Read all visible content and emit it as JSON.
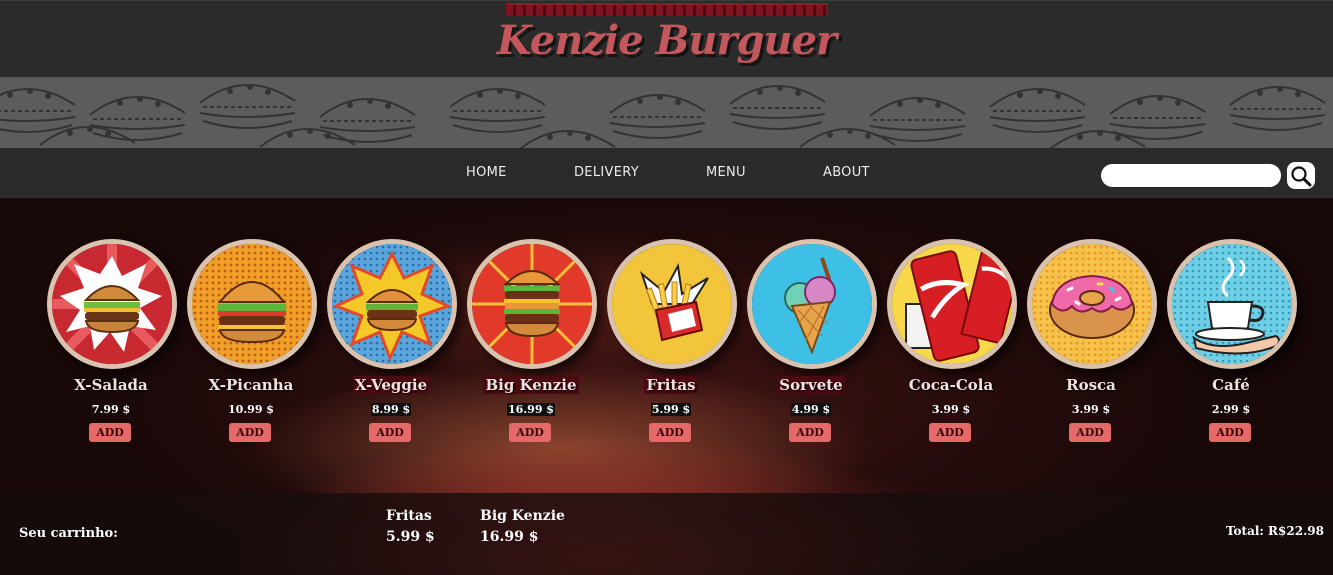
{
  "header": {
    "logo": "Kenzie Burguer"
  },
  "nav": {
    "items": [
      {
        "label": "HOME"
      },
      {
        "label": "DELIVERY"
      },
      {
        "label": "MENU"
      },
      {
        "label": "ABOUT"
      }
    ],
    "search": {
      "value": "",
      "placeholder": ""
    }
  },
  "products": [
    {
      "name": "X-Salada",
      "price": "7.99 $",
      "add": "ADD",
      "icon": "burger-pop-art-icon"
    },
    {
      "name": "X-Picanha",
      "price": "10.99 $",
      "add": "ADD",
      "icon": "burger-pop-art-icon"
    },
    {
      "name": "X-Veggie",
      "price": "8.99 $",
      "add": "ADD",
      "icon": "burger-pop-art-icon"
    },
    {
      "name": "Big Kenzie",
      "price": "16.99 $",
      "add": "ADD",
      "icon": "double-burger-icon"
    },
    {
      "name": "Fritas",
      "price": "5.99 $",
      "add": "ADD",
      "icon": "fries-icon"
    },
    {
      "name": "Sorvete",
      "price": "4.99 $",
      "add": "ADD",
      "icon": "ice-cream-icon"
    },
    {
      "name": "Coca-Cola",
      "price": "3.99 $",
      "add": "ADD",
      "icon": "soda-can-icon"
    },
    {
      "name": "Rosca",
      "price": "3.99 $",
      "add": "ADD",
      "icon": "donut-icon"
    },
    {
      "name": "Café",
      "price": "2.99 $",
      "add": "ADD",
      "icon": "coffee-cup-icon"
    }
  ],
  "cart": {
    "label": "Seu carrinho:",
    "items": [
      {
        "name": "Fritas",
        "price": "5.99 $"
      },
      {
        "name": "Big Kenzie",
        "price": "16.99 $"
      }
    ],
    "total": "Total: R$22.98"
  },
  "colors": {
    "accent": "#c2575c",
    "button": "#e36a69",
    "header_bg": "#2b2b2b"
  }
}
